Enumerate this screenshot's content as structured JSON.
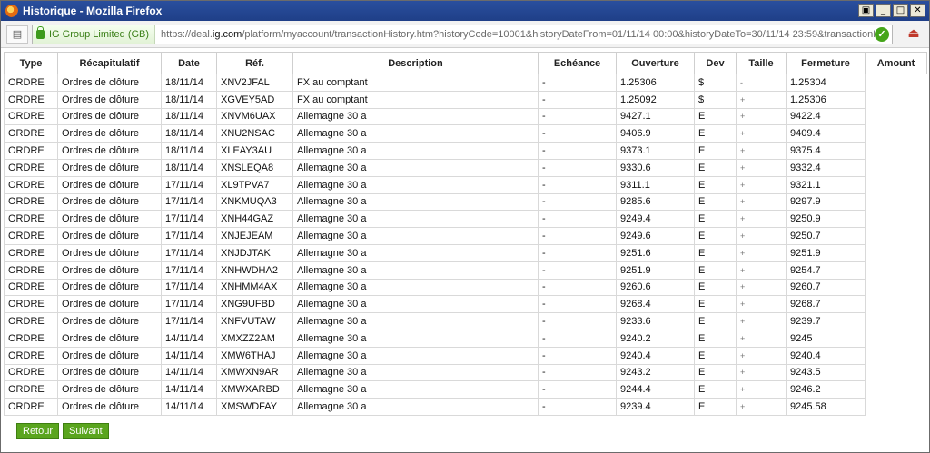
{
  "window": {
    "title": "Historique - Mozilla Firefox"
  },
  "navbar": {
    "identity_label": "IG Group Limited (GB)",
    "url_prefix": "https://deal.",
    "url_domain": "ig.com",
    "url_rest": "/platform/myaccount/transactionHistory.htm?historyCode=10001&historyDateFrom=01/11/14 00:00&historyDateTo=30/11/14 23:59&transactionHistoryPageNumber="
  },
  "icons": {
    "firefox": "firefox-icon",
    "tabs": "tabs-icon",
    "lock": "lock-icon",
    "ok": "check-circle-icon",
    "addon": "addon-icon"
  },
  "colors": {
    "titlebar": "#2a4f9e",
    "green_button": "#5aa51e",
    "secure_green": "#3a7f17"
  },
  "table": {
    "headers": [
      "Type",
      "Récapitulatif",
      "Date",
      "Réf.",
      "Description",
      "Echéance",
      "Ouverture",
      "Dev",
      "Taille",
      "Fermeture",
      "Amount"
    ],
    "rows": [
      [
        "ORDRE",
        "Ordres de clôture",
        "18/11/14",
        "XNV2JFAL",
        "FX au comptant",
        "-",
        "1.25306",
        "$",
        "-",
        "1.25304",
        ""
      ],
      [
        "ORDRE",
        "Ordres de clôture",
        "18/11/14",
        "XGVEY5AD",
        "FX au comptant",
        "-",
        "1.25092",
        "$",
        "+",
        "1.25306",
        ""
      ],
      [
        "ORDRE",
        "Ordres de clôture",
        "18/11/14",
        "XNVM6UAX",
        "Allemagne 30 a",
        "-",
        "9427.1",
        "E",
        "+",
        "9422.4",
        ""
      ],
      [
        "ORDRE",
        "Ordres de clôture",
        "18/11/14",
        "XNU2NSAC",
        "Allemagne 30 a",
        "-",
        "9406.9",
        "E",
        "+",
        "9409.4",
        ""
      ],
      [
        "ORDRE",
        "Ordres de clôture",
        "18/11/14",
        "XLEAY3AU",
        "Allemagne 30 a",
        "-",
        "9373.1",
        "E",
        "+",
        "9375.4",
        ""
      ],
      [
        "ORDRE",
        "Ordres de clôture",
        "18/11/14",
        "XNSLEQA8",
        "Allemagne 30 a",
        "-",
        "9330.6",
        "E",
        "+",
        "9332.4",
        ""
      ],
      [
        "ORDRE",
        "Ordres de clôture",
        "17/11/14",
        "XL9TPVA7",
        "Allemagne 30 a",
        "-",
        "9311.1",
        "E",
        "+",
        "9321.1",
        ""
      ],
      [
        "ORDRE",
        "Ordres de clôture",
        "17/11/14",
        "XNKMUQA3",
        "Allemagne 30 a",
        "-",
        "9285.6",
        "E",
        "+",
        "9297.9",
        ""
      ],
      [
        "ORDRE",
        "Ordres de clôture",
        "17/11/14",
        "XNH44GAZ",
        "Allemagne 30 a",
        "-",
        "9249.4",
        "E",
        "+",
        "9250.9",
        ""
      ],
      [
        "ORDRE",
        "Ordres de clôture",
        "17/11/14",
        "XNJEJEAM",
        "Allemagne 30 a",
        "-",
        "9249.6",
        "E",
        "+",
        "9250.7",
        ""
      ],
      [
        "ORDRE",
        "Ordres de clôture",
        "17/11/14",
        "XNJDJTAK",
        "Allemagne 30 a",
        "-",
        "9251.6",
        "E",
        "+",
        "9251.9",
        ""
      ],
      [
        "ORDRE",
        "Ordres de clôture",
        "17/11/14",
        "XNHWDHA2",
        "Allemagne 30 a",
        "-",
        "9251.9",
        "E",
        "+",
        "9254.7",
        ""
      ],
      [
        "ORDRE",
        "Ordres de clôture",
        "17/11/14",
        "XNHMM4AX",
        "Allemagne 30 a",
        "-",
        "9260.6",
        "E",
        "+",
        "9260.7",
        ""
      ],
      [
        "ORDRE",
        "Ordres de clôture",
        "17/11/14",
        "XNG9UFBD",
        "Allemagne 30 a",
        "-",
        "9268.4",
        "E",
        "+",
        "9268.7",
        ""
      ],
      [
        "ORDRE",
        "Ordres de clôture",
        "17/11/14",
        "XNFVUTAW",
        "Allemagne 30 a",
        "-",
        "9233.6",
        "E",
        "+",
        "9239.7",
        ""
      ],
      [
        "ORDRE",
        "Ordres de clôture",
        "14/11/14",
        "XMXZZ2AM",
        "Allemagne 30 a",
        "-",
        "9240.2",
        "E",
        "+",
        "9245",
        ""
      ],
      [
        "ORDRE",
        "Ordres de clôture",
        "14/11/14",
        "XMW6THAJ",
        "Allemagne 30 a",
        "-",
        "9240.4",
        "E",
        "+",
        "9240.4",
        ""
      ],
      [
        "ORDRE",
        "Ordres de clôture",
        "14/11/14",
        "XMWXN9AR",
        "Allemagne 30 a",
        "-",
        "9243.2",
        "E",
        "+",
        "9243.5",
        ""
      ],
      [
        "ORDRE",
        "Ordres de clôture",
        "14/11/14",
        "XMWXARBD",
        "Allemagne 30 a",
        "-",
        "9244.4",
        "E",
        "+",
        "9246.2",
        ""
      ],
      [
        "ORDRE",
        "Ordres de clôture",
        "14/11/14",
        "XMSWDFAY",
        "Allemagne 30 a",
        "-",
        "9239.4",
        "E",
        "+",
        "9245.58",
        ""
      ]
    ]
  },
  "buttons": {
    "back_label": "Retour",
    "next_label": "Suivant"
  }
}
